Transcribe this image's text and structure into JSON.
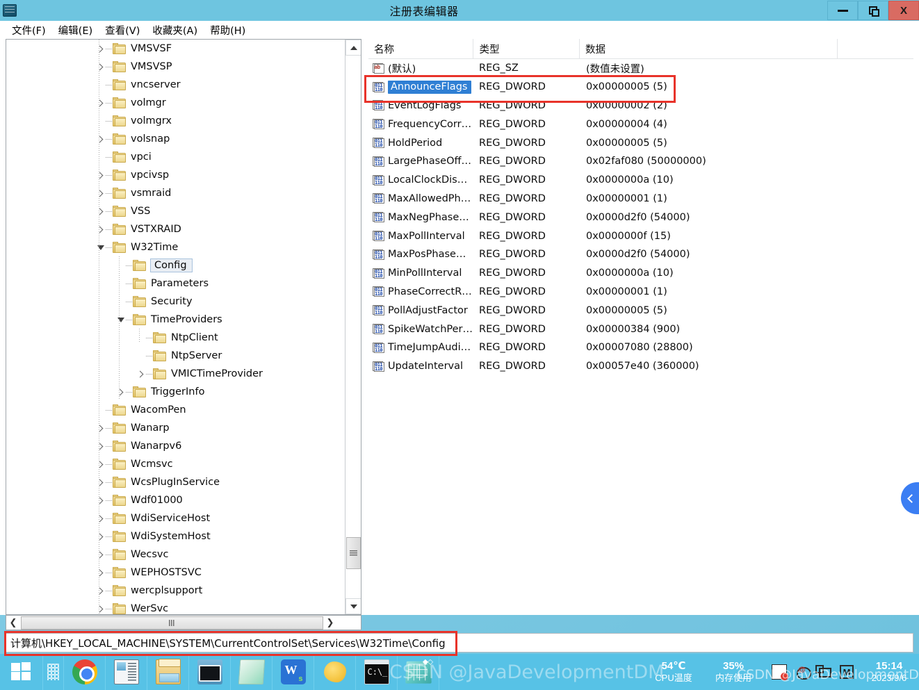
{
  "window": {
    "title": "注册表编辑器",
    "icon": "regedit-icon",
    "minimize_label": "",
    "maximize_label": "",
    "close_label": "X"
  },
  "menubar": {
    "items": [
      {
        "label": "文件(F)"
      },
      {
        "label": "编辑(E)"
      },
      {
        "label": "查看(V)"
      },
      {
        "label": "收藏夹(A)"
      },
      {
        "label": "帮助(H)"
      }
    ]
  },
  "tree": {
    "nodes": [
      {
        "label": "VMSVSF",
        "indent": 0,
        "expander": "collapsed",
        "selected": false
      },
      {
        "label": "VMSVSP",
        "indent": 0,
        "expander": "collapsed",
        "selected": false
      },
      {
        "label": "vncserver",
        "indent": 0,
        "expander": "none",
        "selected": false
      },
      {
        "label": "volmgr",
        "indent": 0,
        "expander": "collapsed",
        "selected": false
      },
      {
        "label": "volmgrx",
        "indent": 0,
        "expander": "none",
        "selected": false
      },
      {
        "label": "volsnap",
        "indent": 0,
        "expander": "collapsed",
        "selected": false
      },
      {
        "label": "vpci",
        "indent": 0,
        "expander": "none",
        "selected": false
      },
      {
        "label": "vpcivsp",
        "indent": 0,
        "expander": "collapsed",
        "selected": false
      },
      {
        "label": "vsmraid",
        "indent": 0,
        "expander": "collapsed",
        "selected": false
      },
      {
        "label": "VSS",
        "indent": 0,
        "expander": "collapsed",
        "selected": false
      },
      {
        "label": "VSTXRAID",
        "indent": 0,
        "expander": "collapsed",
        "selected": false
      },
      {
        "label": "W32Time",
        "indent": 0,
        "expander": "expanded",
        "selected": false
      },
      {
        "label": "Config",
        "indent": 1,
        "expander": "none",
        "selected": true
      },
      {
        "label": "Parameters",
        "indent": 1,
        "expander": "none",
        "selected": false
      },
      {
        "label": "Security",
        "indent": 1,
        "expander": "none",
        "selected": false
      },
      {
        "label": "TimeProviders",
        "indent": 1,
        "expander": "expanded",
        "selected": false
      },
      {
        "label": "NtpClient",
        "indent": 2,
        "expander": "none",
        "selected": false
      },
      {
        "label": "NtpServer",
        "indent": 2,
        "expander": "none",
        "selected": false
      },
      {
        "label": "VMICTimeProvider",
        "indent": 2,
        "expander": "collapsed",
        "selected": false
      },
      {
        "label": "TriggerInfo",
        "indent": 1,
        "expander": "collapsed",
        "selected": false
      },
      {
        "label": "WacomPen",
        "indent": 0,
        "expander": "none",
        "selected": false
      },
      {
        "label": "Wanarp",
        "indent": 0,
        "expander": "collapsed",
        "selected": false
      },
      {
        "label": "Wanarpv6",
        "indent": 0,
        "expander": "collapsed",
        "selected": false
      },
      {
        "label": "Wcmsvc",
        "indent": 0,
        "expander": "collapsed",
        "selected": false
      },
      {
        "label": "WcsPlugInService",
        "indent": 0,
        "expander": "collapsed",
        "selected": false
      },
      {
        "label": "Wdf01000",
        "indent": 0,
        "expander": "collapsed",
        "selected": false
      },
      {
        "label": "WdiServiceHost",
        "indent": 0,
        "expander": "collapsed",
        "selected": false
      },
      {
        "label": "WdiSystemHost",
        "indent": 0,
        "expander": "collapsed",
        "selected": false
      },
      {
        "label": "Wecsvc",
        "indent": 0,
        "expander": "collapsed",
        "selected": false
      },
      {
        "label": "WEPHOSTSVC",
        "indent": 0,
        "expander": "collapsed",
        "selected": false
      },
      {
        "label": "wercplsupport",
        "indent": 0,
        "expander": "collapsed",
        "selected": false
      },
      {
        "label": "WerSvc",
        "indent": 0,
        "expander": "collapsed",
        "selected": false
      }
    ]
  },
  "list": {
    "columns": [
      "名称",
      "类型",
      "数据"
    ],
    "rows": [
      {
        "name": "(默认)",
        "type": "REG_SZ",
        "data": "(数值未设置)",
        "icon": "string-value-icon",
        "selected": false
      },
      {
        "name": "AnnounceFlags",
        "type": "REG_DWORD",
        "data": "0x00000005 (5)",
        "icon": "dword-value-icon",
        "selected": true
      },
      {
        "name": "EventLogFlags",
        "type": "REG_DWORD",
        "data": "0x00000002 (2)",
        "icon": "dword-value-icon",
        "selected": false
      },
      {
        "name": "FrequencyCorr…",
        "type": "REG_DWORD",
        "data": "0x00000004 (4)",
        "icon": "dword-value-icon",
        "selected": false
      },
      {
        "name": "HoldPeriod",
        "type": "REG_DWORD",
        "data": "0x00000005 (5)",
        "icon": "dword-value-icon",
        "selected": false
      },
      {
        "name": "LargePhaseOff…",
        "type": "REG_DWORD",
        "data": "0x02faf080 (50000000)",
        "icon": "dword-value-icon",
        "selected": false
      },
      {
        "name": "LocalClockDis…",
        "type": "REG_DWORD",
        "data": "0x0000000a (10)",
        "icon": "dword-value-icon",
        "selected": false
      },
      {
        "name": "MaxAllowedPh…",
        "type": "REG_DWORD",
        "data": "0x00000001 (1)",
        "icon": "dword-value-icon",
        "selected": false
      },
      {
        "name": "MaxNegPhase…",
        "type": "REG_DWORD",
        "data": "0x0000d2f0 (54000)",
        "icon": "dword-value-icon",
        "selected": false
      },
      {
        "name": "MaxPollInterval",
        "type": "REG_DWORD",
        "data": "0x0000000f (15)",
        "icon": "dword-value-icon",
        "selected": false
      },
      {
        "name": "MaxPosPhase…",
        "type": "REG_DWORD",
        "data": "0x0000d2f0 (54000)",
        "icon": "dword-value-icon",
        "selected": false
      },
      {
        "name": "MinPollInterval",
        "type": "REG_DWORD",
        "data": "0x0000000a (10)",
        "icon": "dword-value-icon",
        "selected": false
      },
      {
        "name": "PhaseCorrectR…",
        "type": "REG_DWORD",
        "data": "0x00000001 (1)",
        "icon": "dword-value-icon",
        "selected": false
      },
      {
        "name": "PollAdjustFactor",
        "type": "REG_DWORD",
        "data": "0x00000005 (5)",
        "icon": "dword-value-icon",
        "selected": false
      },
      {
        "name": "SpikeWatchPer…",
        "type": "REG_DWORD",
        "data": "0x00000384 (900)",
        "icon": "dword-value-icon",
        "selected": false
      },
      {
        "name": "TimeJumpAudi…",
        "type": "REG_DWORD",
        "data": "0x00007080 (28800)",
        "icon": "dword-value-icon",
        "selected": false
      },
      {
        "name": "UpdateInterval",
        "type": "REG_DWORD",
        "data": "0x00057e40 (360000)",
        "icon": "dword-value-icon",
        "selected": false
      }
    ]
  },
  "statusbar": {
    "path": "计算机\\HKEY_LOCAL_MACHINE\\SYSTEM\\CurrentControlSet\\Services\\W32Time\\Config"
  },
  "taskbar": {
    "apps": [
      {
        "name": "chrome",
        "icon": "chrome-icon"
      },
      {
        "name": "docviewer",
        "icon": "document-viewer-icon"
      },
      {
        "name": "explorer",
        "icon": "file-explorer-icon"
      },
      {
        "name": "remote",
        "icon": "remote-desktop-icon"
      },
      {
        "name": "note",
        "icon": "note-icon"
      },
      {
        "name": "wps",
        "icon": "wps-office-icon"
      },
      {
        "name": "blob",
        "icon": "yellow-app-icon"
      },
      {
        "name": "cmd",
        "icon": "command-prompt-icon"
      },
      {
        "name": "regedit",
        "icon": "registry-editor-icon"
      }
    ],
    "tray": {
      "cpu_value": "54℃",
      "cpu_label": "CPU温度",
      "mem_value": "35%",
      "mem_label": "内存使用",
      "icons": [
        "document-tray-icon",
        "mail-tray-icon",
        "network-tray-icon",
        "m-tray-icon"
      ],
      "time": "15:14",
      "date": "2023/9/6"
    }
  },
  "watermark": {
    "text": "CSDN @JavaDevelopmentDM",
    "text2": "CSDN @JavaDevelopmentDM"
  },
  "colors": {
    "titlebar": "#6ec5e0",
    "taskbar": "#57c2e6",
    "selection": "#2f7fd4",
    "annotation": "#e8332a",
    "close_button": "#d96b62"
  }
}
